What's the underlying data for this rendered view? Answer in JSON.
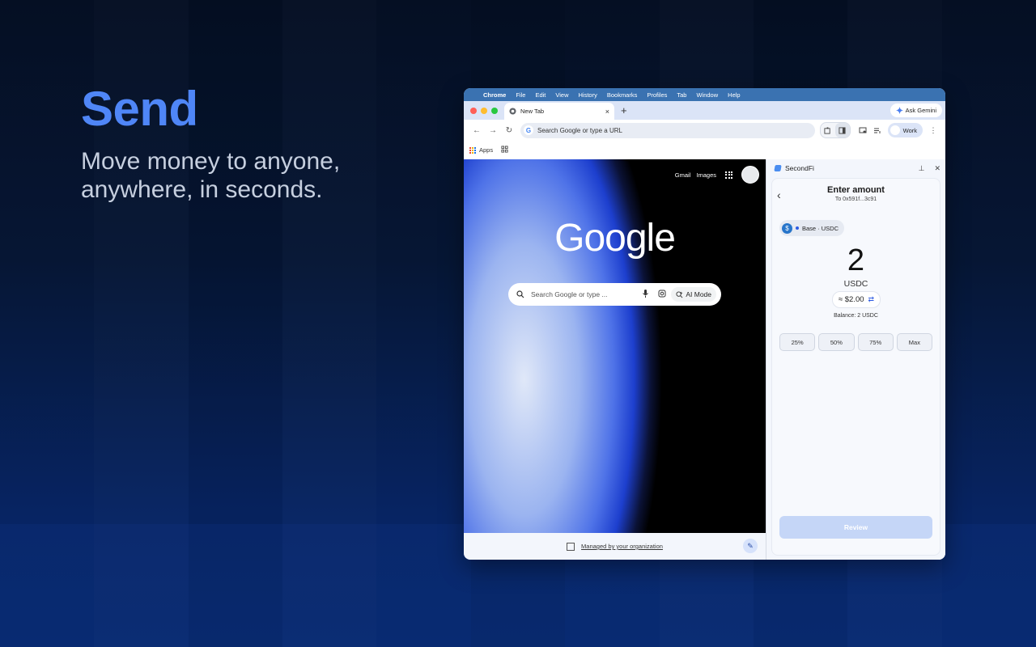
{
  "hero": {
    "title": "Send",
    "subtitle": "Move money to anyone, anywhere, in seconds."
  },
  "colors": {
    "accent": "#4f86f7",
    "subtitle": "#c6cfdf",
    "traffic_close": "#ff5f57",
    "traffic_min": "#febc2e",
    "traffic_max": "#28c840",
    "usdc_blue": "#2775ca",
    "review_disabled": "#c5d6f7"
  },
  "mac_menubar": {
    "apple": "",
    "items": [
      "Chrome",
      "File",
      "Edit",
      "View",
      "History",
      "Bookmarks",
      "Profiles",
      "Tab",
      "Window",
      "Help"
    ]
  },
  "browser": {
    "tab_title": "New Tab",
    "tab_close": "×",
    "new_tab": "+",
    "ask_gemini": "Ask Gemini",
    "omnibox_placeholder": "Search Google or type a URL",
    "profile_label": "Work",
    "bookmarks": {
      "apps_label": "Apps"
    },
    "icons": [
      "back-arrow-icon",
      "forward-arrow-icon",
      "reload-icon",
      "extension-icon",
      "side-panel-icon",
      "cast-icon",
      "reading-list-icon",
      "kebab-menu-icon"
    ]
  },
  "ntp": {
    "gmail": "Gmail",
    "images": "Images",
    "logo": "Google",
    "search_placeholder": "Search Google or type ...",
    "ai_mode": "AI Mode",
    "managed_text": "Managed by your organization"
  },
  "side_panel": {
    "app_name": "SecondFi",
    "title": "Enter amount",
    "recipient": "To 0x591f...3c91",
    "chain_label": "Base · USDC",
    "amount": "2",
    "currency": "USDC",
    "usd_value": "≈ $2.00",
    "balance": "Balance: 2 USDC",
    "presets": [
      "25%",
      "50%",
      "75%",
      "Max"
    ],
    "review_label": "Review"
  }
}
